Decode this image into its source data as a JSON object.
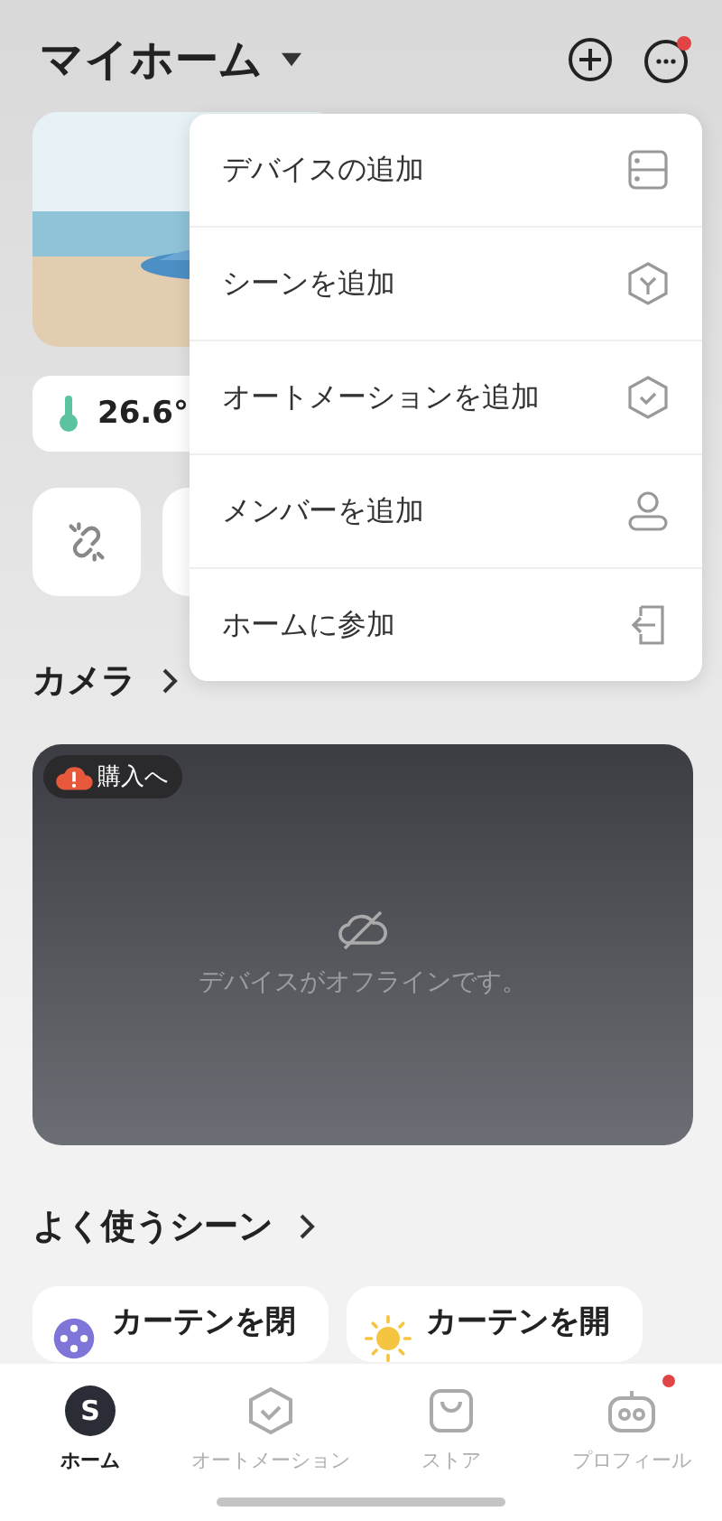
{
  "header": {
    "title": "マイホーム"
  },
  "sensor": {
    "temperature": "26.6°"
  },
  "camera": {
    "heading": "カメラ",
    "badge": "購入へ",
    "status": "デバイスがオフラインです。"
  },
  "scenes": {
    "heading": "よく使うシーン",
    "items": [
      {
        "label": "カーテンを閉",
        "kind": "film"
      },
      {
        "label": "カーテンを開",
        "kind": "sun"
      }
    ]
  },
  "menu": {
    "items": [
      {
        "label": "デバイスの追加",
        "kind": "device"
      },
      {
        "label": "シーンを追加",
        "kind": "scene"
      },
      {
        "label": "オートメーションを追加",
        "kind": "automation"
      },
      {
        "label": "メンバーを追加",
        "kind": "member"
      },
      {
        "label": "ホームに参加",
        "kind": "join"
      }
    ]
  },
  "tabbar": {
    "items": [
      {
        "label": "ホーム",
        "kind": "home",
        "selected": true,
        "avatar": "S"
      },
      {
        "label": "オートメーション",
        "kind": "automation",
        "selected": false
      },
      {
        "label": "ストア",
        "kind": "store",
        "selected": false
      },
      {
        "label": "プロフィール",
        "kind": "profile",
        "selected": false,
        "dot": true
      }
    ]
  }
}
